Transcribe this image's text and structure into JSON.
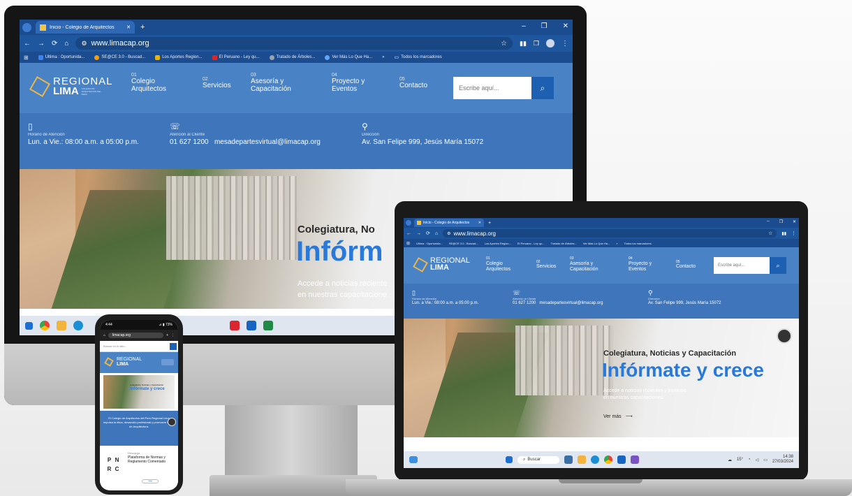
{
  "browser": {
    "tab_title": "Inicio - Colegio de Arquitectos",
    "tab_add": "+",
    "url": "www.limacap.org",
    "window_controls": [
      "–",
      "❐",
      "✕"
    ],
    "nav_buttons": [
      "←",
      "→",
      "⟳",
      "⌂"
    ],
    "bookmarks": [
      "Ultima : Oportunida...",
      "SE@CE 3.0 - Buscad...",
      "Los Aportes Region...",
      "El Peruano - Ley qu...",
      "Tratado de Árboles...",
      "Ver Más Lo Que Ha..."
    ],
    "bookmarks_overflow": "»",
    "all_bookmarks": "Todos los marcadores"
  },
  "site": {
    "logo_line1": "REGIONAL",
    "logo_line2": "LIMA",
    "logo_sub": "COLEGIO DE ARQUITECTOS DEL PERÚ",
    "nav": [
      {
        "num": "01",
        "label": "Colegio Arquitectos"
      },
      {
        "num": "02",
        "label": "Servicios"
      },
      {
        "num": "03",
        "label": "Asesoría y Capacitación"
      },
      {
        "num": "04",
        "label": "Proyecto y Eventos"
      },
      {
        "num": "05",
        "label": "Contacto"
      }
    ],
    "search_placeholder": "Escribe aquí...",
    "info": {
      "hours_label": "Horario de Atención",
      "hours_value": "Lun. a Vie.: 08:00 a.m. a 05:00 p.m.",
      "client_label": "Atención al Cliente",
      "phone": "01 627 1200",
      "email": "mesadepartesvirtual@limacap.org",
      "address_label": "Dirección",
      "address_value": "Av. San Felipe 999, Jesús María 15072"
    },
    "hero_kicker_monitor": "Colegiatura, No",
    "hero_title_monitor": "Infórm",
    "hero_body_monitor_1": "Accede a noticias reciente",
    "hero_body_monitor_2": "en nuestras capacitacione",
    "hero_kicker": "Colegiatura, Noticias y Capacitación",
    "hero_title": "Infórmate y crece",
    "hero_body_1": "Accede a noticias recientes y participa",
    "hero_body_2": "en nuestras capacitaciones.",
    "hero_cta": "Ver más"
  },
  "laptop_taskbar": {
    "search": "Buscar",
    "temp": "15°",
    "time": "14:38",
    "date": "27/03/2024"
  },
  "phone": {
    "status_time": "4:44",
    "status_right": "⊿ ▮ 73%",
    "url": "limacap.org",
    "search_placeholder": "Buscar en el sitio...",
    "kicker": "Colegiatura, Noticias y Capacitación",
    "title": "Infórmate y crece",
    "blue_text": "El Colegio de Arquitectos del Perú Regional Lima impulsa la ética, desarrollo profesional y promueve la Ley de Arquitectura.",
    "pnrc_label": "Descarga",
    "pnrc_title": "Plataforma de Normas y Reglamento Comentado",
    "pnrc_letters": [
      "P",
      "N",
      "R",
      "C"
    ]
  },
  "colors": {
    "browser_dark": "#1b4c8f",
    "site_blue": "#4a82c6",
    "accent_blue": "#2a78d8",
    "logo_gold": "#e8b64a"
  }
}
